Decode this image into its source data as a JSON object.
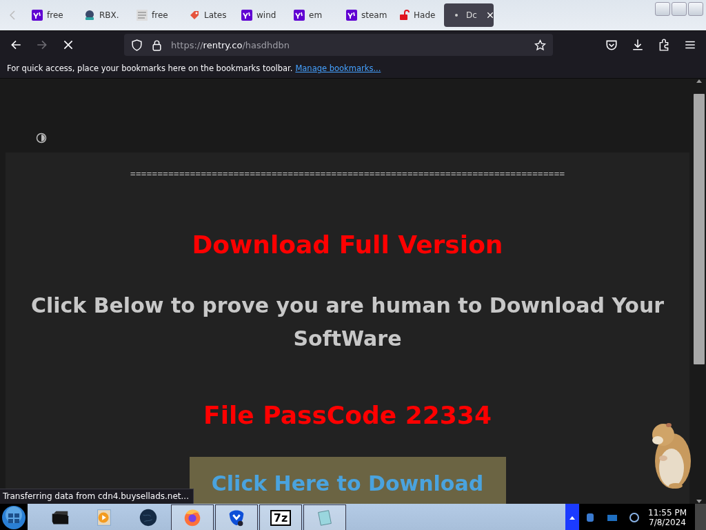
{
  "tabs": [
    {
      "title": "free",
      "selected": false
    },
    {
      "title": "RBX.",
      "selected": false
    },
    {
      "title": "free",
      "selected": false
    },
    {
      "title": "Lates",
      "selected": false
    },
    {
      "title": "wind",
      "selected": false
    },
    {
      "title": "em",
      "selected": false
    },
    {
      "title": "steam",
      "selected": false
    },
    {
      "title": "Hade",
      "selected": false
    },
    {
      "title": "Dc",
      "selected": true
    }
  ],
  "address_bar": {
    "url_prefix": "https://",
    "url_host": "rentry.co",
    "url_path": "/hasdhdbn"
  },
  "bookmarks_bar": {
    "message": "For quick access, place your bookmarks here on the bookmarks toolbar.",
    "link": "Manage bookmarks..."
  },
  "page": {
    "divider": "================================================================================",
    "title": "Download Full Version",
    "subtitle": "Click Below to prove you are human to Download Your SoftWare",
    "passcode": "File PassCode 22334",
    "download_button": "Click Here to Download"
  },
  "status": "Transferring data from cdn4.buysellads.net...",
  "taskbar": {
    "apps": [
      {
        "active": false
      },
      {
        "active": false
      },
      {
        "active": false
      },
      {
        "active": true
      },
      {
        "active": true
      },
      {
        "active": true,
        "label": "7z"
      },
      {
        "active": true
      }
    ],
    "time": "11:55 PM",
    "date": "7/8/2024"
  }
}
